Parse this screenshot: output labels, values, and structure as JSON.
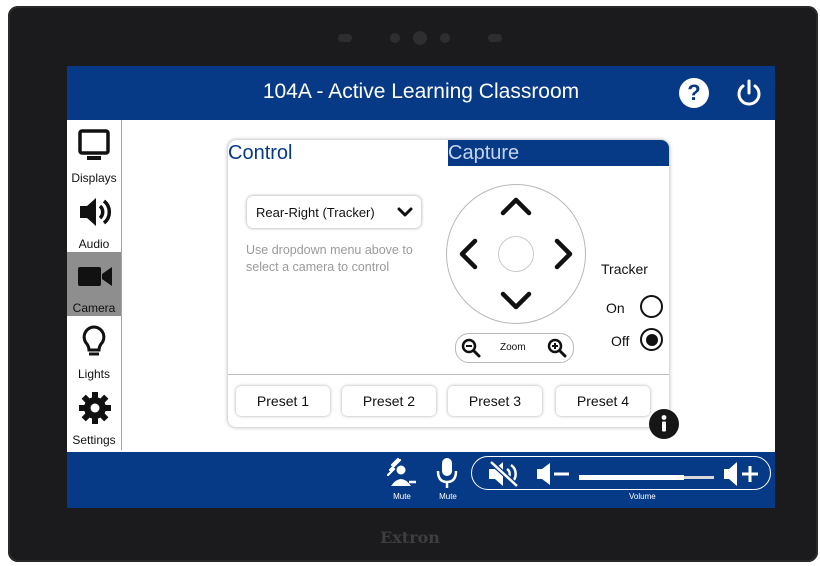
{
  "header": {
    "title": "104A - Active Learning Classroom",
    "help_label": "?"
  },
  "sidebar": {
    "items": [
      {
        "label": "Displays",
        "icon": "monitor-icon",
        "active": false
      },
      {
        "label": "Audio",
        "icon": "speaker-icon",
        "active": false
      },
      {
        "label": "Camera",
        "icon": "video-camera-icon",
        "active": true
      },
      {
        "label": "Lights",
        "icon": "lightbulb-icon",
        "active": false
      },
      {
        "label": "Settings",
        "icon": "gear-icon",
        "active": false
      }
    ]
  },
  "camera_panel": {
    "tabs": [
      {
        "label": "Control",
        "selected": true
      },
      {
        "label": "Capture",
        "selected": false
      }
    ],
    "camera_select": {
      "value": "Rear-Right (Tracker)"
    },
    "hint": "Use dropdown menu above to select a camera to control",
    "zoom_label": "Zoom",
    "tracker": {
      "label": "Tracker",
      "on_label": "On",
      "off_label": "Off",
      "selected": "Off"
    },
    "presets": [
      "Preset 1",
      "Preset 2",
      "Preset 3",
      "Preset 4"
    ]
  },
  "bottom_bar": {
    "mute_label_1": "Mute",
    "mute_label_2": "Mute",
    "volume_label": "Volume",
    "volume_level": 0.78
  },
  "device_brand": "Extron",
  "colors": {
    "primary": "#073a86",
    "tab_inactive_text": "#c7d3ea",
    "active_nav": "#8e8e8e"
  }
}
